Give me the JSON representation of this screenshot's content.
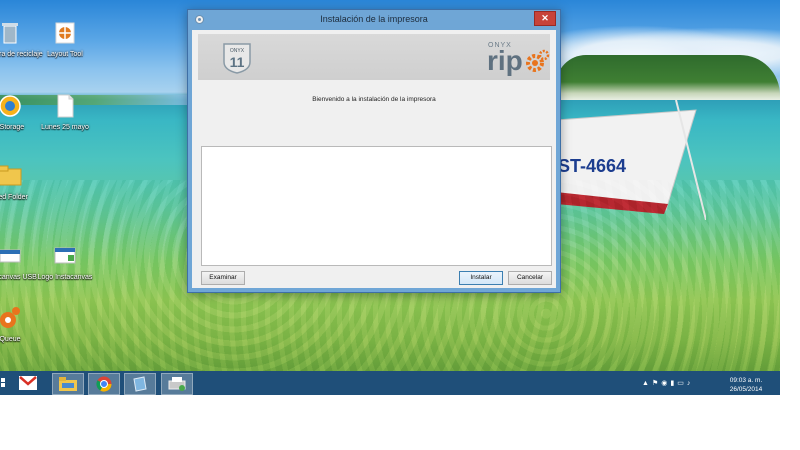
{
  "desktop": {
    "icons": [
      {
        "name": "recycle-bin",
        "label": "Papelera de reciclaje"
      },
      {
        "name": "layout-tool",
        "label": "Layout Tool"
      },
      {
        "name": "webstorage",
        "label": "bStorage"
      },
      {
        "name": "lunes-25-mayo",
        "label": "Lunes 25 mayo"
      },
      {
        "name": "shared-folder",
        "label": "ared Folder"
      },
      {
        "name": "instacanvas-usb",
        "label": "Instacanvas USB"
      },
      {
        "name": "logo-instacanvas",
        "label": "Logo Instacanvas"
      },
      {
        "name": "queue",
        "label": "Queue"
      }
    ],
    "boat_text": "ST-4664"
  },
  "window": {
    "title": "Instalación de la impresora",
    "close_label": "✕",
    "logo_onyx_badge": "ONYX",
    "logo_onyx_number": "11",
    "logo_brand_small": "ONYX",
    "logo_brand_word": "rip",
    "welcome_text": "Bienvenido a la instalación de la impresora",
    "buttons": {
      "browse": "Examinar",
      "install": "Instalar",
      "cancel": "Cancelar"
    }
  },
  "taskbar": {
    "clock_time": "09:03 a. m.",
    "clock_date": "26/05/2014",
    "pinned": [
      "gmail",
      "file-explorer",
      "chrome",
      "notepad",
      "printer-install"
    ]
  },
  "colors": {
    "titlebar": "#6fa6d6",
    "close": "#c7433a",
    "taskbar": "#1f4f79"
  }
}
